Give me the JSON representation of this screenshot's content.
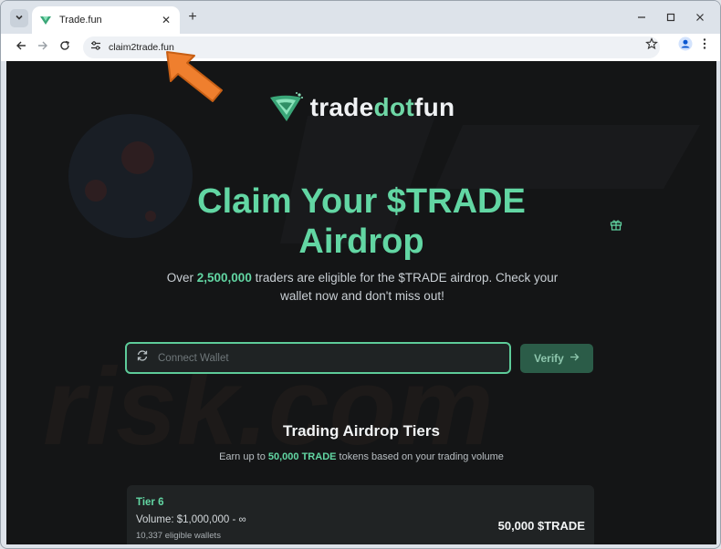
{
  "browser": {
    "tab_title": "Trade.fun",
    "url": "claim2trade.fun"
  },
  "colors": {
    "accent": "#62d6a3",
    "page_bg": "#141516",
    "card_bg": "#202324",
    "verify_bg": "#2b5c48",
    "pointer_arrow": "#ef7f2e"
  },
  "logo": {
    "part1": "trade",
    "part2": "dot",
    "part3": "fun"
  },
  "hero": {
    "title_line1": "Claim Your $TRADE",
    "title_line2": "Airdrop",
    "sub_before": "Over ",
    "sub_count": "2,500,000",
    "sub_after": " traders are eligible for the $TRADE airdrop. Check your wallet now and don't miss out!"
  },
  "wallet": {
    "placeholder": "Connect Wallet",
    "verify_label": "Verify"
  },
  "tiers": {
    "title": "Trading Airdrop Tiers",
    "sub_before": "Earn up to ",
    "sub_amount": "50,000 TRADE",
    "sub_after": " tokens based on your trading volume",
    "items": [
      {
        "name": "Tier 6",
        "volume": "Volume: $1,000,000 - ∞",
        "wallets": "10,337 eligible wallets",
        "amount": "50,000 $TRADE"
      }
    ]
  },
  "icons": {
    "tab_menu": "chevron-down-icon",
    "back": "back-arrow-icon",
    "forward": "forward-arrow-icon",
    "reload": "reload-icon",
    "site_info": "tune-icon",
    "bookmark": "star-icon",
    "profile": "profile-icon",
    "menu": "kebab-menu-icon",
    "gift": "gift-icon",
    "wallet_refresh": "refresh-icon",
    "verify_arrow": "arrow-right-icon"
  }
}
